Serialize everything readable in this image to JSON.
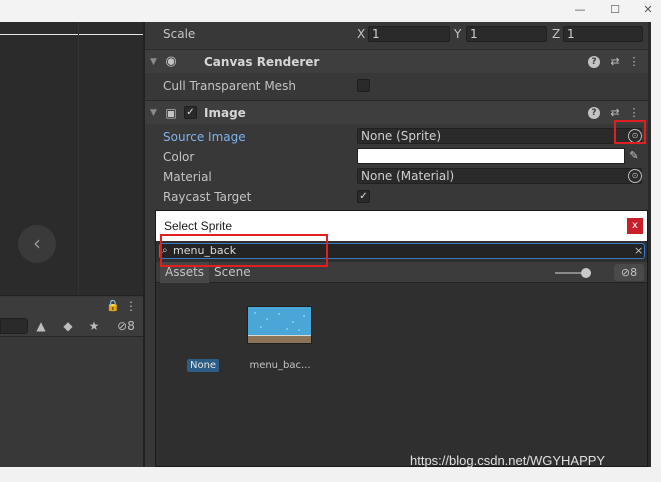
{
  "window": {
    "minimize_glyph": "—",
    "maximize_glyph": "☐",
    "close_glyph": "✕"
  },
  "scene": {
    "nav_prev_glyph": "‹"
  },
  "left_panel": {
    "toolbar_icons": [
      "lock-icon",
      "menu-icon"
    ],
    "lock_glyph": "🔒",
    "menu_glyph": "⋮",
    "filter_icons": [
      "filter-by-type-icon",
      "filter-by-label-icon",
      "favorites-star-icon",
      "hidden-count-icon"
    ],
    "filter_type_glyph": "▲",
    "label_glyph": "◆",
    "star_glyph": "★",
    "hidden_glyph": "⊘",
    "hidden_count": "8"
  },
  "inspector": {
    "scale": {
      "label": "Scale",
      "x_axis": "X",
      "x_value": "1",
      "y_axis": "Y",
      "y_value": "1",
      "z_axis": "Z",
      "z_value": "1"
    },
    "canvas_renderer": {
      "title": "Canvas Renderer",
      "fold_glyph": "▼",
      "eye_glyph": "◉",
      "cull_label": "Cull Transparent Mesh",
      "cull_checked": false
    },
    "image": {
      "title": "Image",
      "fold_glyph": "▼",
      "icon_glyph": "▣",
      "enabled_glyph": "✓",
      "source_image_label": "Source Image",
      "source_image_value": "None (Sprite)",
      "color_label": "Color",
      "color_value": "#ffffff",
      "material_label": "Material",
      "material_value": "None (Material)",
      "raycast_label": "Raycast Target",
      "raycast_checked_glyph": "✓",
      "picker_glyph": "⊙",
      "eyedropper_glyph": "✎"
    },
    "header_icons": {
      "help_glyph": "?",
      "preset_glyph": "⇄",
      "more_glyph": "⋮"
    },
    "accent_label_color": "#7fb2ec"
  },
  "select_sprite": {
    "title": "Select Sprite",
    "close_glyph": "x",
    "search_value": "menu_back",
    "search_glyph": "⌕",
    "clear_glyph": "×",
    "tabs": [
      {
        "label": "Assets",
        "active": true
      },
      {
        "label": "Scene",
        "active": false
      }
    ],
    "hidden_count": "8",
    "hidden_glyph": "⊘",
    "items": [
      {
        "label": "None",
        "selected": true
      },
      {
        "label": "menu_bac...",
        "selected": false
      }
    ]
  },
  "watermark": "https://blog.csdn.net/WGYHAPPY",
  "colors": {
    "highlight_box": "#e02020",
    "selection": "#2c5d87",
    "search_focus": "#3b79c4"
  }
}
